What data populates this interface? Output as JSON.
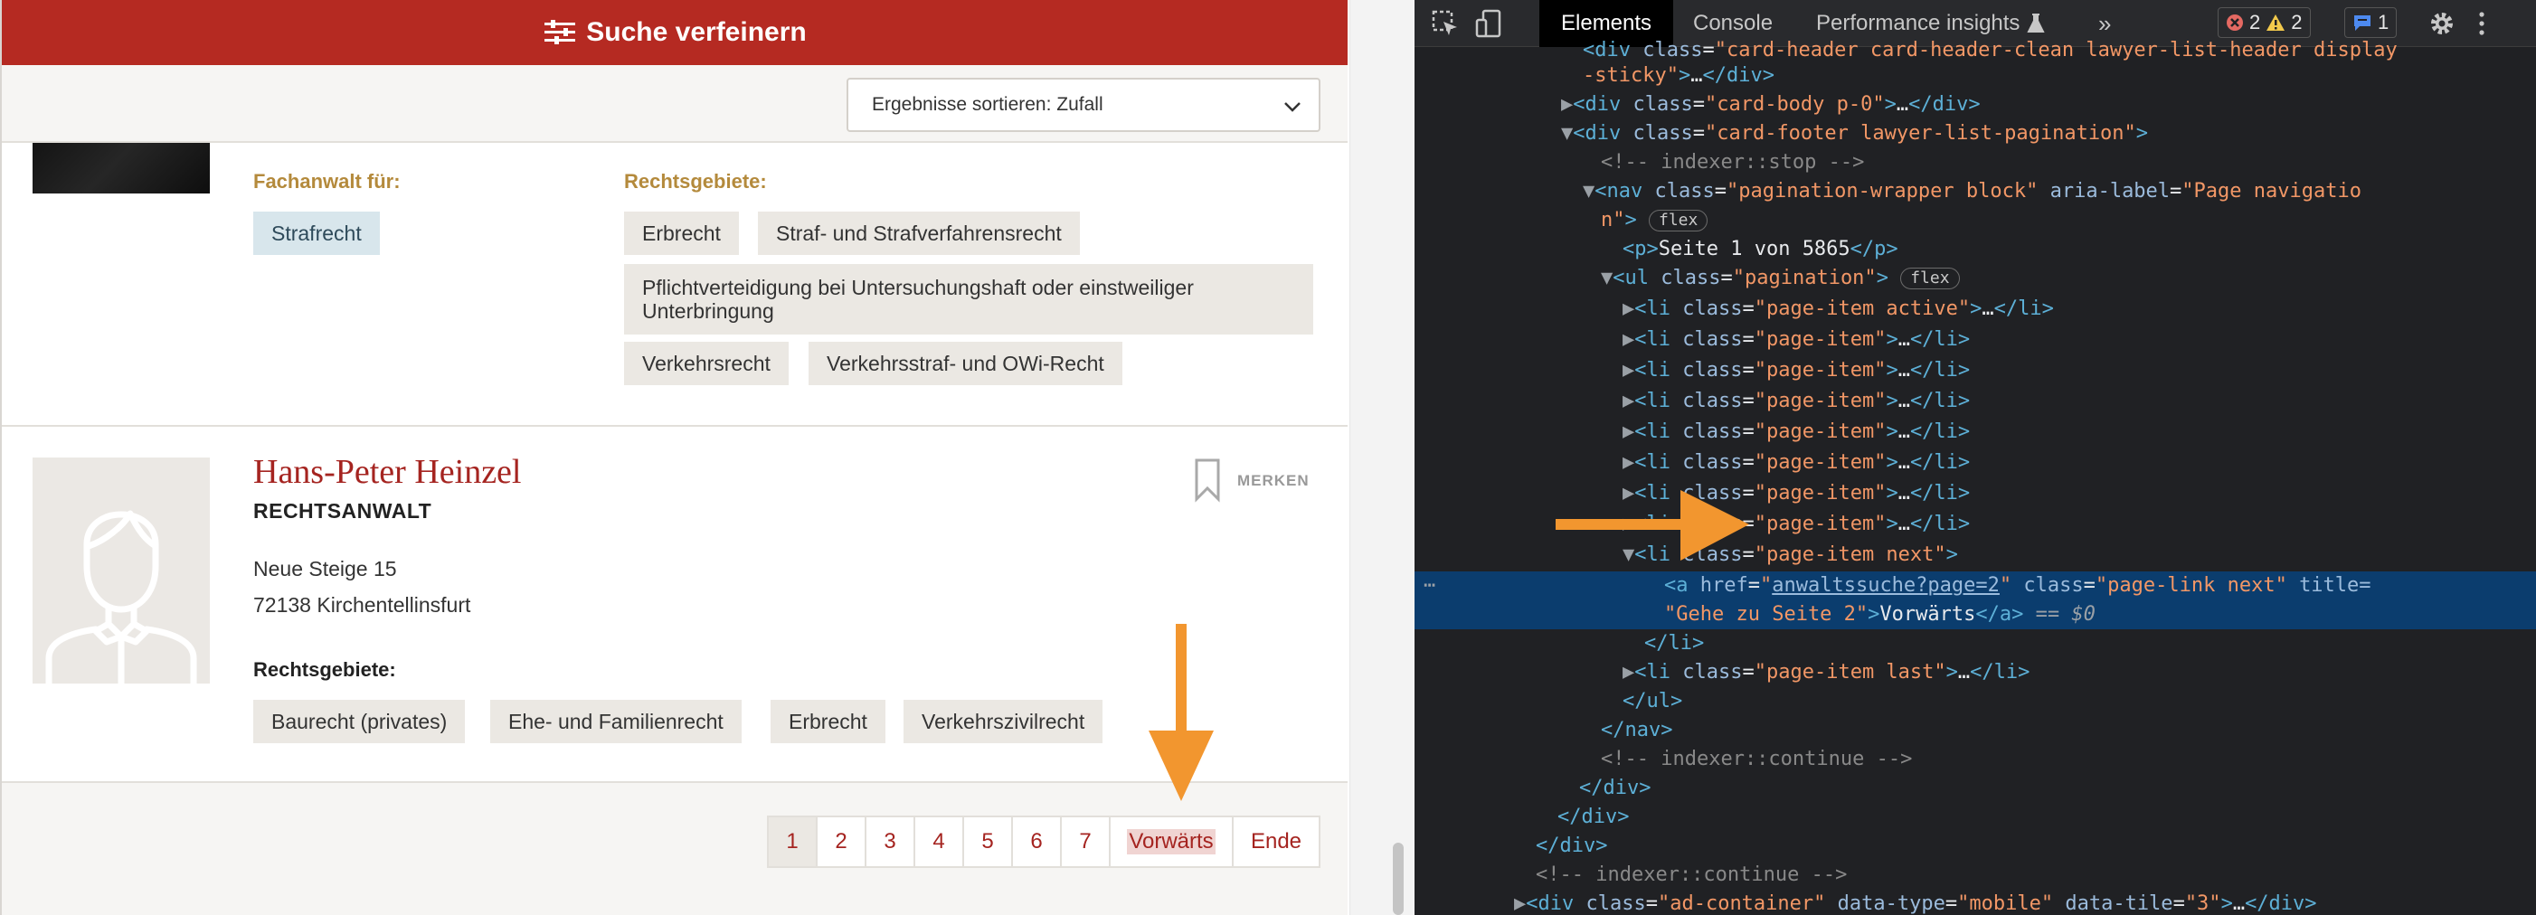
{
  "page": {
    "refine_label": "Suche verfeinern",
    "sort_label": "Ergebnisse sortieren: Zufall",
    "first_card": {
      "fachanwalt_label": "Fachanwalt für:",
      "fachanwalt_tags": [
        "Strafrecht"
      ],
      "rechtsgebiete_label": "Rechtsgebiete:",
      "rechtsgebiete_tags": [
        "Erbrecht",
        "Straf- und Strafverfahrensrecht",
        "Pflichtverteidigung bei Untersuchungshaft oder einstweiliger Unterbringung",
        "Verkehrsrecht",
        "Verkehrsstraf- und OWi-Recht"
      ]
    },
    "lawyer": {
      "name": "Hans-Peter Heinzel",
      "title": "RECHTSANWALT",
      "street": "Neue Steige 15",
      "city": "72138 Kirchentellinsfurt",
      "bookmark_label": "MERKEN",
      "rechtsgebiete_label": "Rechtsgebiete:",
      "tags": [
        "Baurecht (privates)",
        "Ehe- und Familienrecht",
        "Erbrecht",
        "Verkehrszivilrecht"
      ]
    },
    "pagination": [
      "1",
      "2",
      "3",
      "4",
      "5",
      "6",
      "7",
      "Vorwärts",
      "Ende"
    ]
  },
  "devtools": {
    "tabs": [
      "Elements",
      "Console",
      "Performance insights"
    ],
    "more": "»",
    "errors": "2",
    "warnings": "2",
    "messages": "1",
    "lines": {
      "l0a": "div",
      "l0b": "class",
      "l0c": "\"card-header card-header-clean lawyer-list-header display",
      "l1a": "-sticky\"",
      "l1b": ">…</",
      "l1c": "div",
      "l1d": ">",
      "l2_class": "\"card-body p-0\"",
      "l3_class": "\"card-footer lawyer-list-pagination\"",
      "l4": "<!-- indexer::stop -->",
      "l5_class": "\"pagination-wrapper block\"",
      "l5_aria": "aria-label",
      "l5_aria_val": "\"Page navigatio",
      "l6a": "n\"",
      "flex": "flex",
      "p_text": "Seite 1 von 5865",
      "ul_class": "\"pagination\"",
      "li_active": "\"page-item active\"",
      "li_item": "\"page-item\"",
      "li_next": "\"page-item next\"",
      "a_href": "anwaltssuche?page=2",
      "a_class": "\"page-link next\"",
      "a_title_attr": "title=",
      "a_title_val": "\"Gehe zu Seite 2\"",
      "a_text": "Vorwärts",
      "eq0": "== $0",
      "li_last": "\"page-item last\"",
      "cm_continue": "<!-- indexer::continue -->",
      "ad_class": "\"ad-container\"",
      "ad_type_attr": "data-type",
      "ad_type_val": "\"mobile\"",
      "ad_tile_attr": "data-tile",
      "ad_tile_val": "\"3\""
    }
  },
  "colors": {
    "brand_red": "#b52a22",
    "arrow_orange": "#f2962f",
    "devtools_bg": "#202124",
    "selected_row": "#0b3d6e"
  }
}
